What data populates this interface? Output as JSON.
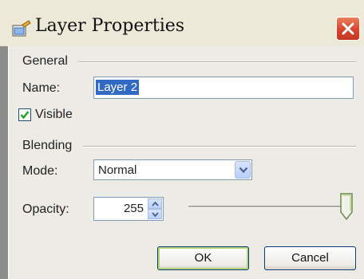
{
  "window": {
    "title": "Layer Properties"
  },
  "general": {
    "heading": "General",
    "name_label": "Name:",
    "name_value": "Layer 2",
    "visible_label": "Visible",
    "visible_checked": true
  },
  "blending": {
    "heading": "Blending",
    "mode_label": "Mode:",
    "mode_value": "Normal",
    "opacity_label": "Opacity:",
    "opacity_value": "255",
    "opacity_slider_level": 1.0
  },
  "buttons": {
    "ok": "OK",
    "cancel": "Cancel"
  },
  "colors": {
    "accent": "#316ac5",
    "close": "#d6452d",
    "check": "#21a121"
  },
  "icons": {
    "title": "layer-properties-icon",
    "close": "close-icon",
    "dropdown": "chevron-down-icon"
  }
}
